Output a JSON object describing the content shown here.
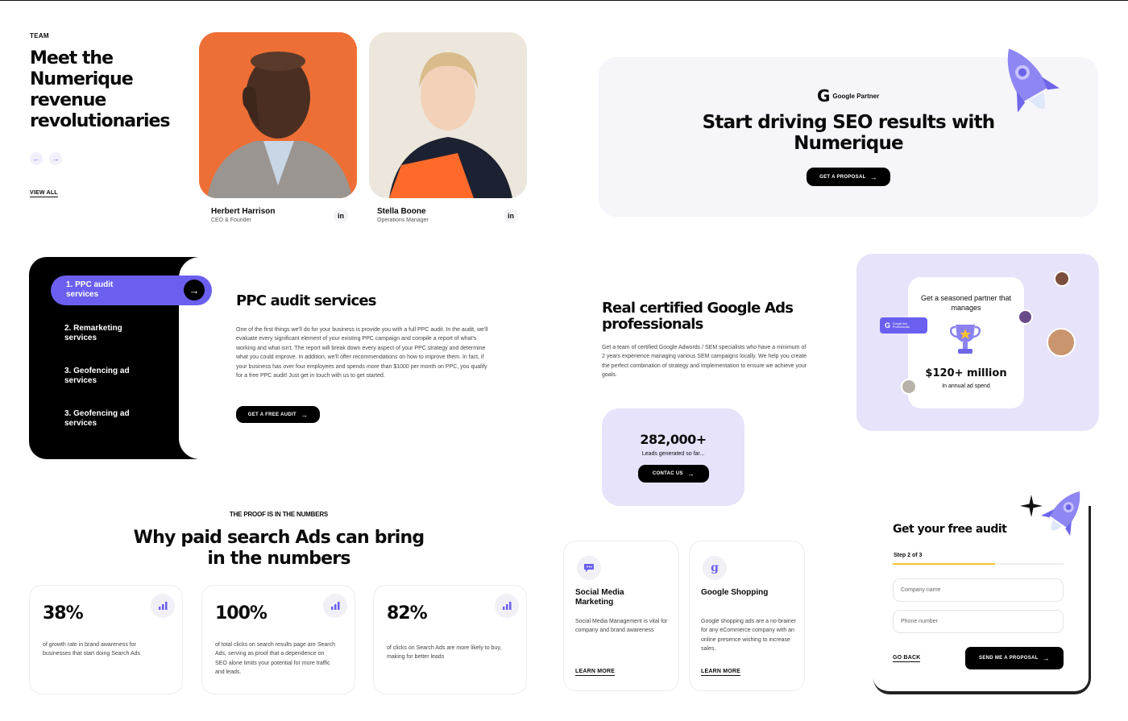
{
  "team": {
    "eyebrow": "TEAM",
    "heading_lines": [
      "Meet the",
      "Numerique",
      "revenue",
      "revolutionaries"
    ],
    "prev_icon": "arrow-left-icon",
    "next_icon": "arrow-right-icon",
    "view_all": "VIEW ALL",
    "members": [
      {
        "name": "Herbert Harrison",
        "role": "CEO & Founder",
        "social": "in"
      },
      {
        "name": "Stella Boone",
        "role": "Operations Manager",
        "social": "in"
      }
    ]
  },
  "seo_cta": {
    "badge": "Google Partner",
    "heading_lines": [
      "Start driving SEO results with",
      "Numerique"
    ],
    "button": "GET A PROPOSAL"
  },
  "ppc": {
    "menu": [
      "1. PPC audit services",
      "2. Remarketing services",
      "3. Geofencing ad services",
      "3. Geofencing ad services"
    ],
    "title": "PPC audit services",
    "body": "One of the first things we'll do for your business is provide you with a full PPC audit. In the audit, we'll evaluate every significant element of your existing PPC campaign and compile a report of what's working and what isn't. The report will break down every aspect of your PPC strategy and determine what you could improve. In addition, we'll offer recommendations on how to improve them. In fact, if your business has over four employees and spends more than $1000 per month on PPC, you qualify for a free PPC audit! Just get in touch with us to get started.",
    "button": "GET A FREE AUDIT"
  },
  "certified": {
    "heading_lines": [
      "Real certified Google Ads",
      "professionals"
    ],
    "body": "Get a team of certified Google Adwords / SEM specialists who have a minimum of 2 years experience managing various SEM campaigns locally. We help you create the perfect combination of strategy and implementation to ensure we achieve your goals.",
    "partner_card": {
      "title": "Get a seasoned partner that manages",
      "amount": "$120+ million",
      "caption": "In annual ad spend",
      "chip": "Google Ads Professionals"
    },
    "leads": {
      "number": "282,000+",
      "caption": "Leads generated so far...",
      "button": "CONTAC US"
    }
  },
  "proof": {
    "eyebrow": "THE PROOF IS IN THE NUMBERS",
    "heading_lines": [
      "Why paid search Ads can bring",
      "in the numbers"
    ],
    "stats": [
      {
        "value": "38%",
        "text": "of growth rate in brand awareness for businesses that start doing Search Ads"
      },
      {
        "value": "100%",
        "text": "of total clicks on search results page are Search Ads, serving as proof that a dependence on SEO alone limits your potential for more traffic and leads."
      },
      {
        "value": "82%",
        "text": "of clicks on Search Ads are more likely to buy, making for better leads"
      }
    ]
  },
  "services": [
    {
      "title": "Social Media Marketing",
      "text": "Social Media Management is vital for company and brand awareness",
      "link": "LEARN MORE",
      "icon": "chat-icon"
    },
    {
      "title": "Google Shopping",
      "text": "Google shopping ads are a no-brainer for any eCommerce company with an online presence wishing to increase sales.",
      "link": "LEARN MORE",
      "icon": "google-shopping-icon"
    }
  ],
  "audit_form": {
    "title": "Get your free audit",
    "step": "Step 2 of 3",
    "progress": 0.6,
    "company_placeholder": "Company name",
    "phone_placeholder": "Phone number",
    "back": "GO BACK",
    "submit": "SEND ME A PROPOSAL"
  },
  "colors": {
    "accent": "#6b5ff0",
    "lavender": "#e6e3fb",
    "progress": "#f2c230",
    "black": "#000000"
  }
}
